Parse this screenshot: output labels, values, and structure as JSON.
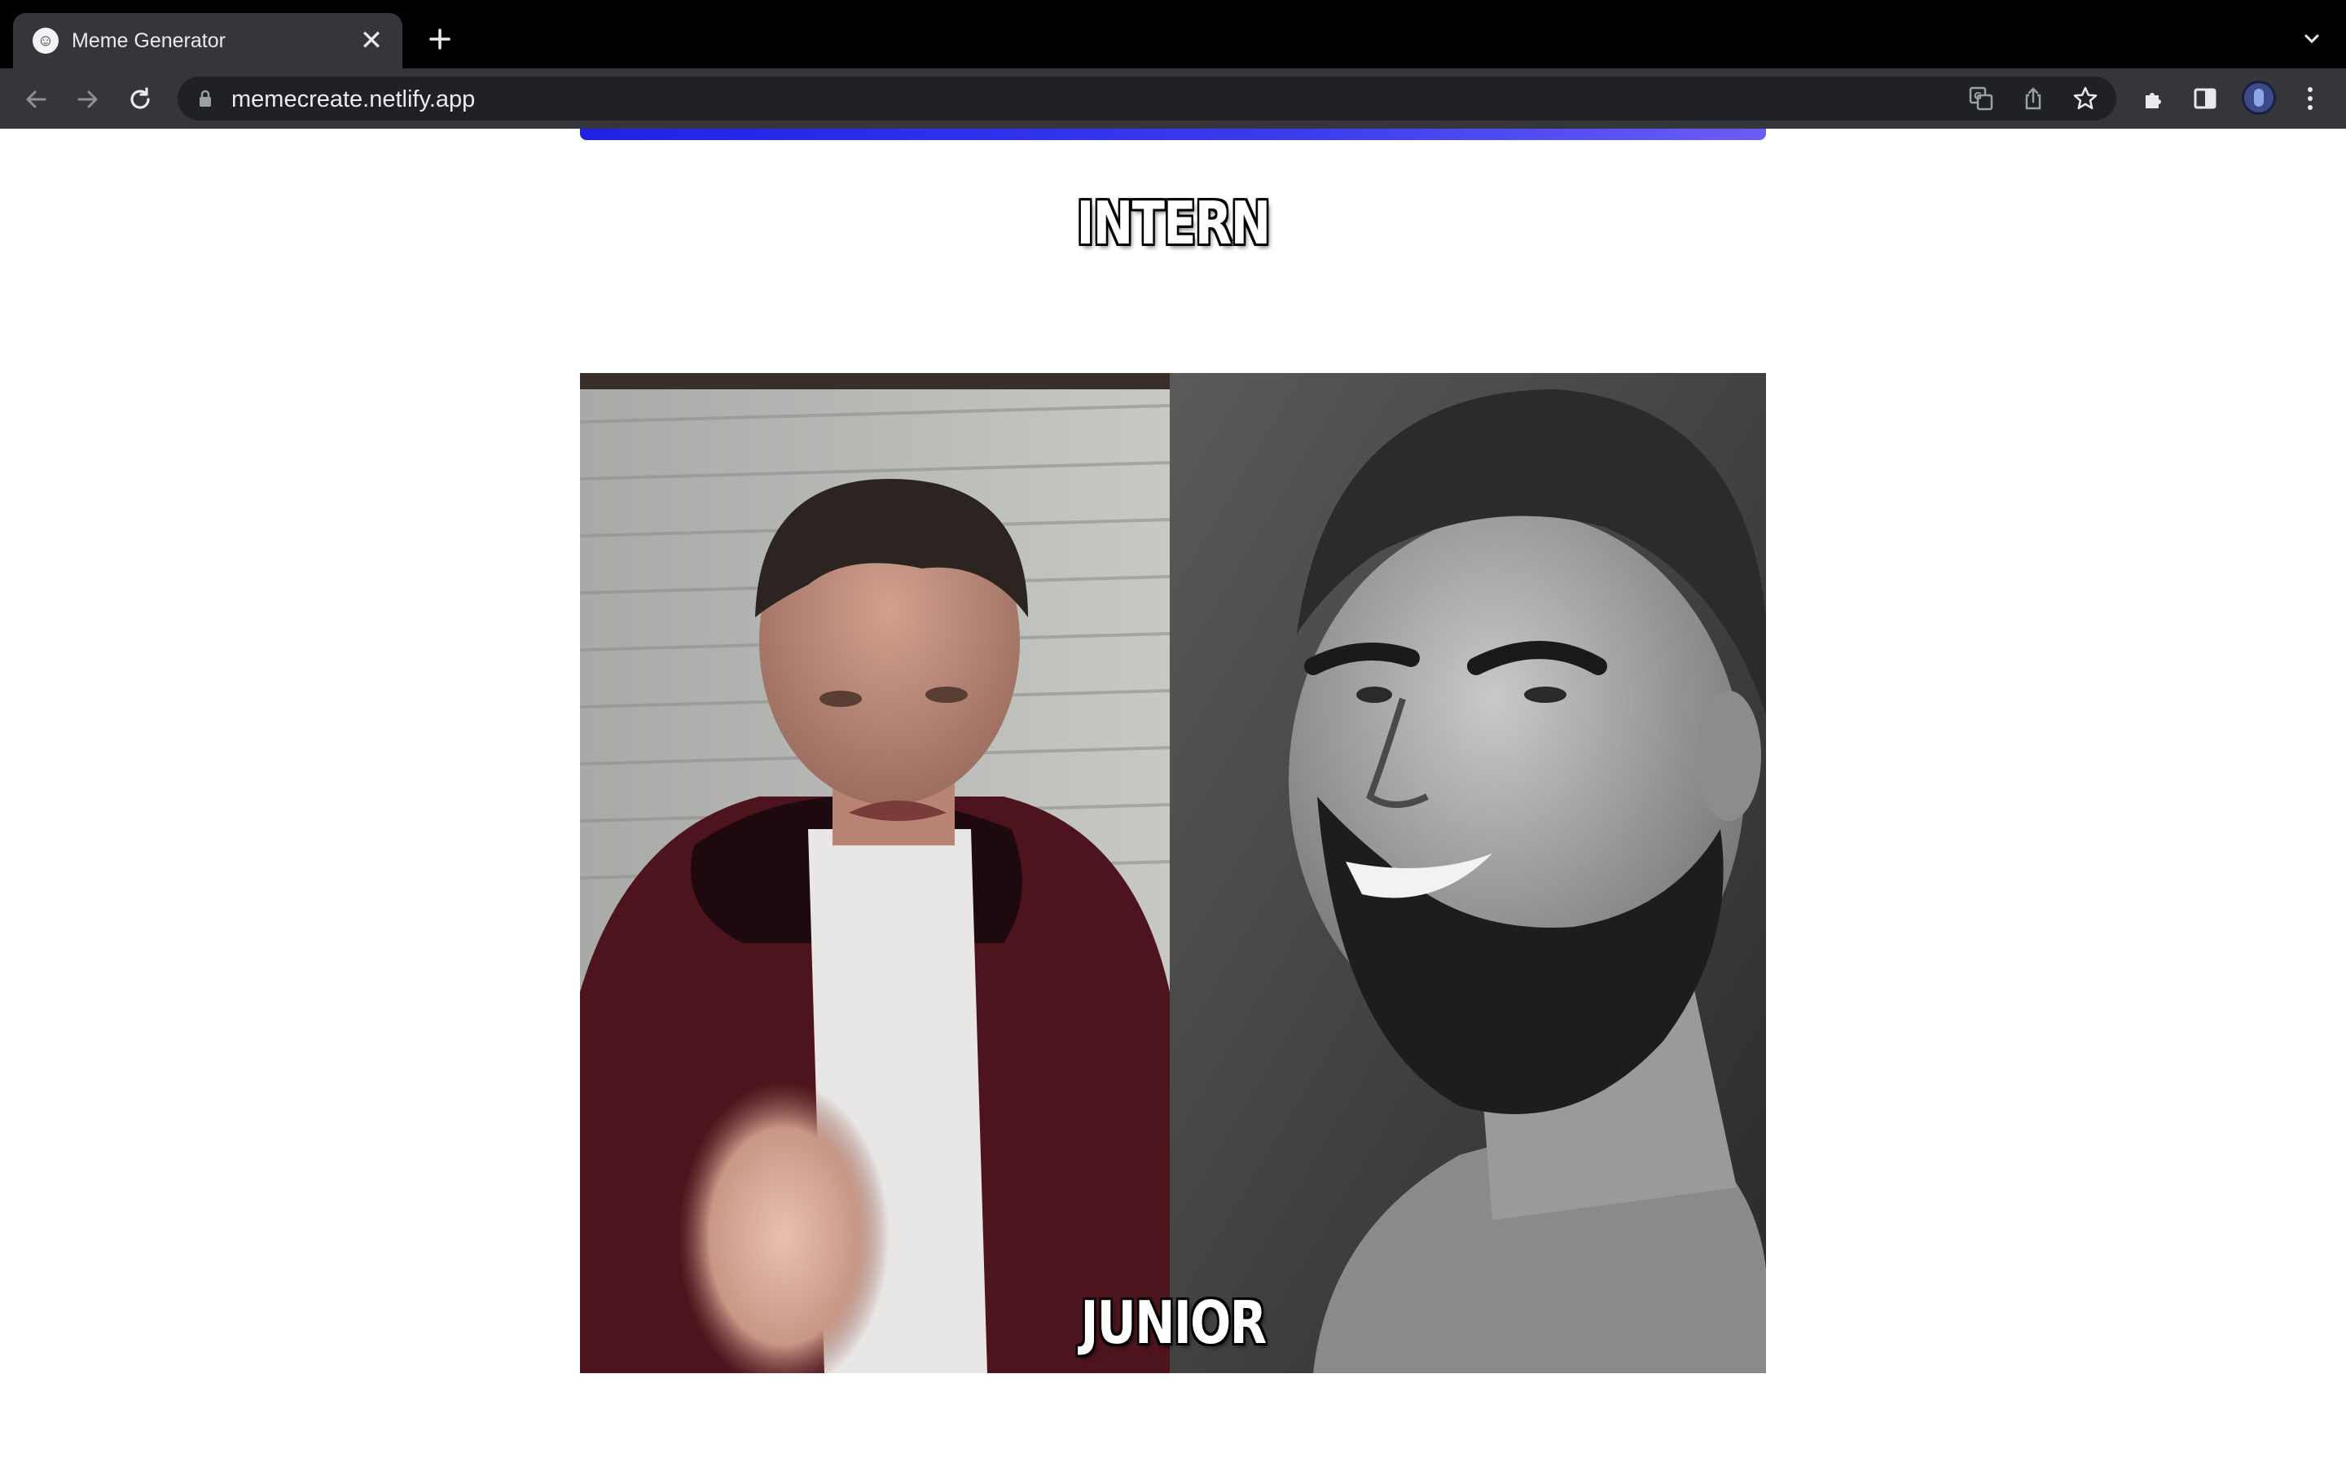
{
  "browser": {
    "tab_title": "Meme Generator",
    "close_symbol": "✕",
    "url": "memecreate.netlify.app",
    "icons": [
      "favicon-icon",
      "close-icon",
      "plus-icon",
      "chevron-down-icon",
      "back-icon",
      "forward-icon",
      "reload-icon",
      "lock-icon",
      "translate-icon",
      "share-icon",
      "star-icon",
      "extensions-icon",
      "side-panel-icon",
      "avatar",
      "kebab-menu-icon"
    ]
  },
  "page": {
    "accent_gradient": [
      "#1e22e8",
      "#6a5cf7"
    ]
  },
  "meme": {
    "top_text": "INTERN",
    "bottom_text": "JUNIOR",
    "image_alt_left": "young man in red jacket",
    "image_alt_right": "bearded man smiling"
  }
}
